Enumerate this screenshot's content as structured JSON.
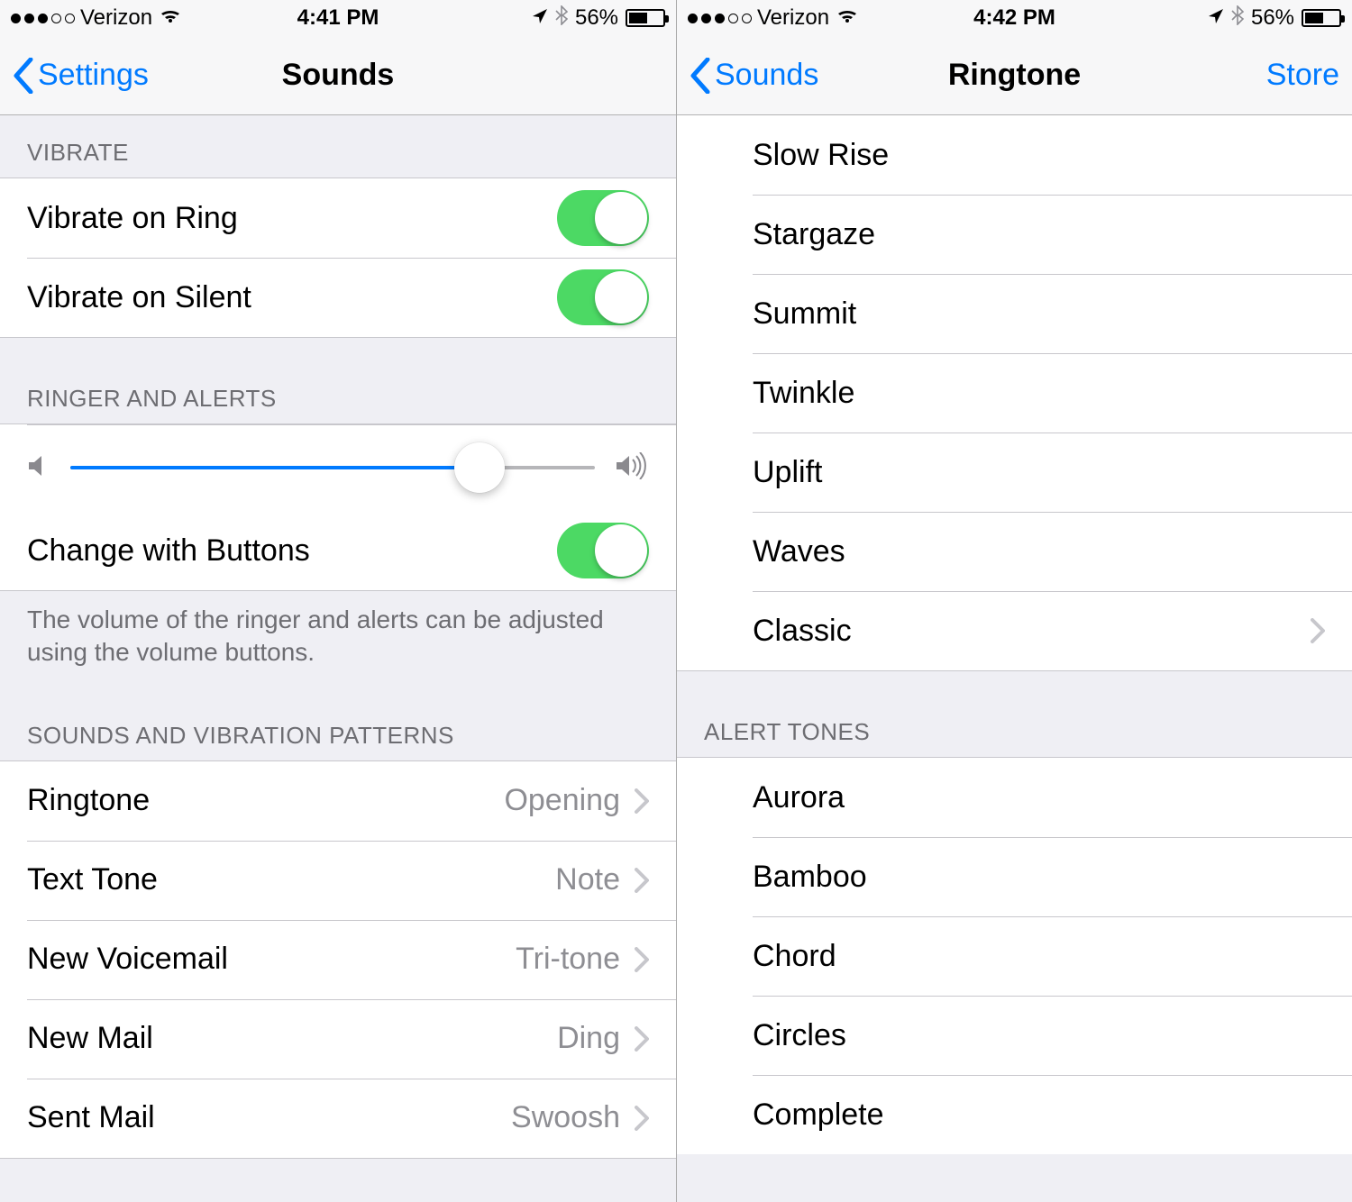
{
  "left": {
    "status": {
      "carrier": "Verizon",
      "time": "4:41 PM",
      "battery_pct": "56%"
    },
    "nav": {
      "back": "Settings",
      "title": "Sounds"
    },
    "sections": {
      "vibrate": {
        "header": "Vibrate",
        "items": [
          {
            "label": "Vibrate on Ring",
            "on": true
          },
          {
            "label": "Vibrate on Silent",
            "on": true
          }
        ]
      },
      "ringer": {
        "header": "Ringer and Alerts",
        "volume_pct": 78,
        "change_label": "Change with Buttons",
        "change_on": true,
        "footer": "The volume of the ringer and alerts can be adjusted using the volume buttons."
      },
      "patterns": {
        "header": "Sounds and Vibration Patterns",
        "items": [
          {
            "label": "Ringtone",
            "value": "Opening"
          },
          {
            "label": "Text Tone",
            "value": "Note"
          },
          {
            "label": "New Voicemail",
            "value": "Tri-tone"
          },
          {
            "label": "New Mail",
            "value": "Ding"
          },
          {
            "label": "Sent Mail",
            "value": "Swoosh"
          }
        ]
      }
    }
  },
  "right": {
    "status": {
      "carrier": "Verizon",
      "time": "4:42 PM",
      "battery_pct": "56%"
    },
    "nav": {
      "back": "Sounds",
      "title": "Ringtone",
      "right": "Store"
    },
    "ringtones": [
      "Slow Rise",
      "Stargaze",
      "Summit",
      "Twinkle",
      "Uplift",
      "Waves",
      "Classic"
    ],
    "alert_header": "Alert Tones",
    "alert_tones": [
      "Aurora",
      "Bamboo",
      "Chord",
      "Circles",
      "Complete"
    ]
  }
}
